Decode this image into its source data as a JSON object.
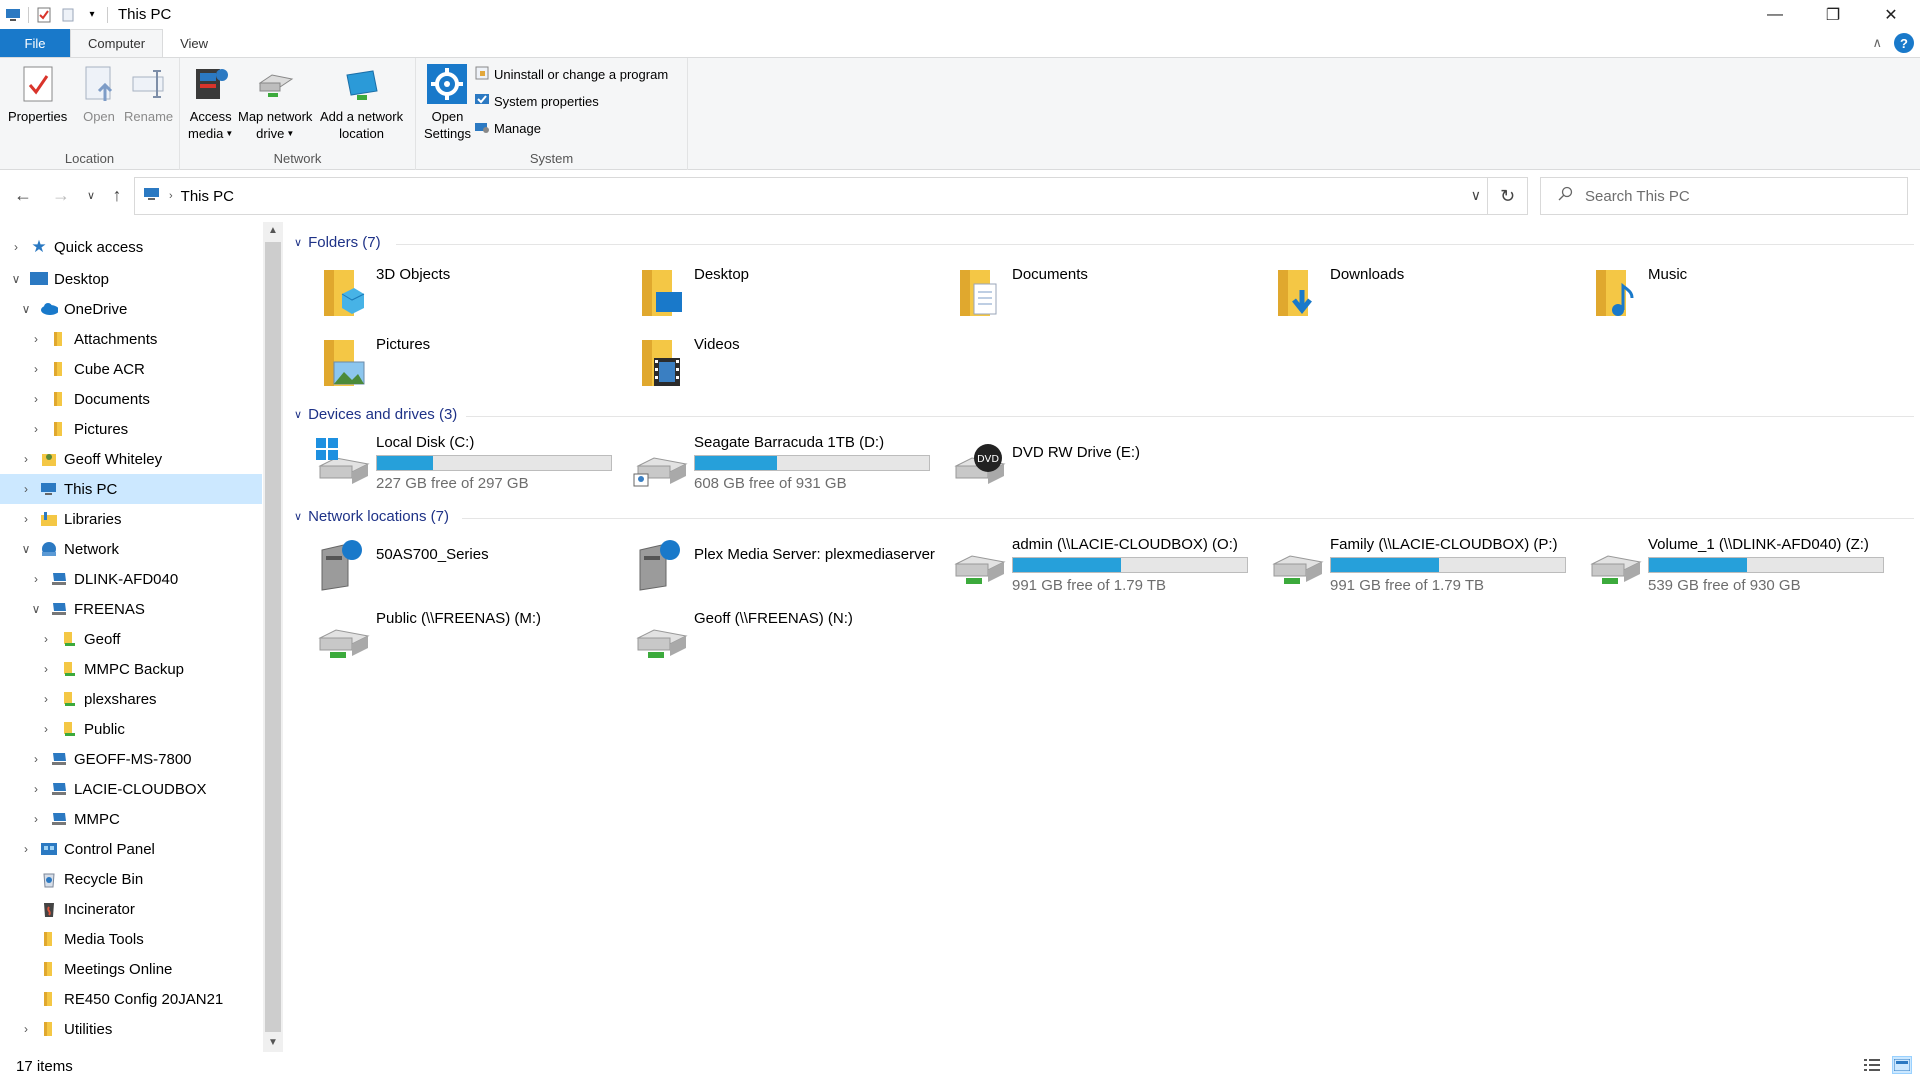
{
  "window": {
    "title": "This PC"
  },
  "tabs": {
    "file": "File",
    "computer": "Computer",
    "view": "View"
  },
  "ribbon": {
    "location": {
      "label": "Location",
      "properties": "Properties",
      "open": "Open",
      "rename": "Rename"
    },
    "network": {
      "label": "Network",
      "access_media_1": "Access",
      "access_media_2": "media",
      "map_drive_1": "Map network",
      "map_drive_2": "drive",
      "add_location_1": "Add a network",
      "add_location_2": "location"
    },
    "system": {
      "label": "System",
      "open_settings_1": "Open",
      "open_settings_2": "Settings",
      "uninstall": "Uninstall or change a program",
      "system_properties": "System properties",
      "manage": "Manage"
    }
  },
  "address": {
    "path": "This PC",
    "search_placeholder": "Search This PC"
  },
  "nav": {
    "items": [
      {
        "label": "Quick access"
      },
      {
        "label": "Desktop"
      },
      {
        "label": "OneDrive"
      },
      {
        "label": "Attachments"
      },
      {
        "label": "Cube ACR"
      },
      {
        "label": "Documents"
      },
      {
        "label": "Pictures"
      },
      {
        "label": "Geoff Whiteley"
      },
      {
        "label": "This PC"
      },
      {
        "label": "Libraries"
      },
      {
        "label": "Network"
      },
      {
        "label": "DLINK-AFD040"
      },
      {
        "label": "FREENAS"
      },
      {
        "label": "Geoff"
      },
      {
        "label": "MMPC Backup"
      },
      {
        "label": "plexshares"
      },
      {
        "label": "Public"
      },
      {
        "label": "GEOFF-MS-7800"
      },
      {
        "label": "LACIE-CLOUDBOX"
      },
      {
        "label": "MMPC"
      },
      {
        "label": "Control Panel"
      },
      {
        "label": "Recycle Bin"
      },
      {
        "label": "Incinerator"
      },
      {
        "label": "Media Tools"
      },
      {
        "label": "Meetings Online"
      },
      {
        "label": "RE450 Config 20JAN21"
      },
      {
        "label": "Utilities"
      }
    ]
  },
  "sections": {
    "folders": {
      "title": "Folders (7)",
      "items": [
        "3D Objects",
        "Desktop",
        "Documents",
        "Downloads",
        "Music",
        "Pictures",
        "Videos"
      ]
    },
    "drives": {
      "title": "Devices and drives (3)",
      "items": [
        {
          "name": "Local Disk (C:)",
          "free": "227 GB free of 297 GB",
          "used_fraction": 0.24
        },
        {
          "name": "Seagate Barracuda 1TB (D:)",
          "free": "608 GB free of 931 GB",
          "used_fraction": 0.35
        },
        {
          "name": "DVD RW Drive (E:)"
        }
      ]
    },
    "network": {
      "title": "Network locations (7)",
      "items": [
        {
          "name": "50AS700_Series"
        },
        {
          "name": "Plex Media Server: plexmediaserver"
        },
        {
          "name": "admin (\\\\LACIE-CLOUDBOX) (O:)",
          "free": "991 GB free of 1.79 TB",
          "used_fraction": 0.46
        },
        {
          "name": "Family (\\\\LACIE-CLOUDBOX) (P:)",
          "free": "991 GB free of 1.79 TB",
          "used_fraction": 0.46
        },
        {
          "name": "Volume_1 (\\\\DLINK-AFD040) (Z:)",
          "free": "539 GB free of 930 GB",
          "used_fraction": 0.42
        },
        {
          "name": "Public (\\\\FREENAS) (M:)"
        },
        {
          "name": "Geoff (\\\\FREENAS) (N:)"
        }
      ]
    }
  },
  "status": {
    "items": "17 items"
  },
  "colors": {
    "accent": "#1979ca",
    "bar_fill": "#26a0da",
    "selection": "#cce8ff",
    "section_header": "#1e3287"
  }
}
